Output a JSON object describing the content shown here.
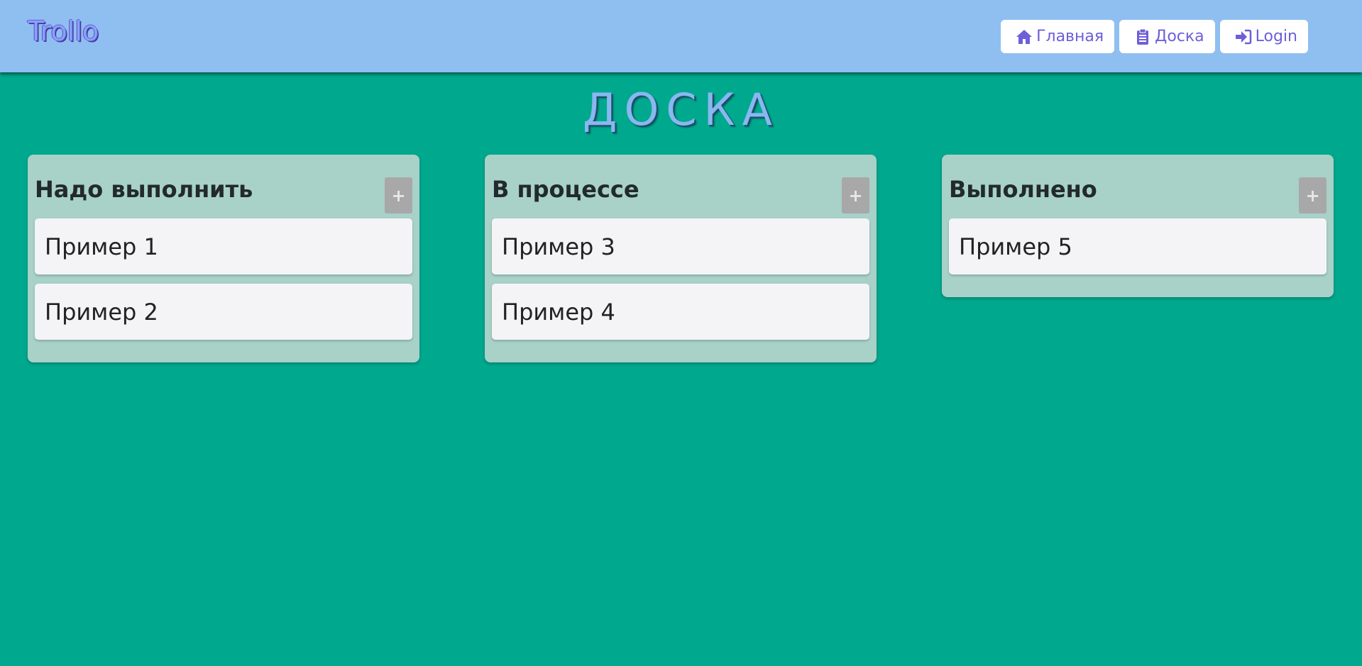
{
  "header": {
    "brand": "Trollo",
    "nav": [
      {
        "label": "Главная",
        "icon": "home-icon"
      },
      {
        "label": "Доска",
        "icon": "clipboard-icon"
      },
      {
        "label": "Login",
        "icon": "login-icon"
      }
    ]
  },
  "board": {
    "title": "ДОСКА",
    "columns": [
      {
        "title": "Надо выполнить",
        "add_label": "+",
        "cards": [
          "Пример 1",
          "Пример 2"
        ]
      },
      {
        "title": "В процессе",
        "add_label": "+",
        "cards": [
          "Пример 3",
          "Пример 4"
        ]
      },
      {
        "title": "Выполнено",
        "add_label": "+",
        "cards": [
          "Пример 5"
        ]
      }
    ]
  },
  "colors": {
    "background": "#00a88e",
    "header": "#8fbff0",
    "column": "#a8d1c8",
    "card": "#f4f4f6",
    "accent": "#6d5fd8"
  }
}
